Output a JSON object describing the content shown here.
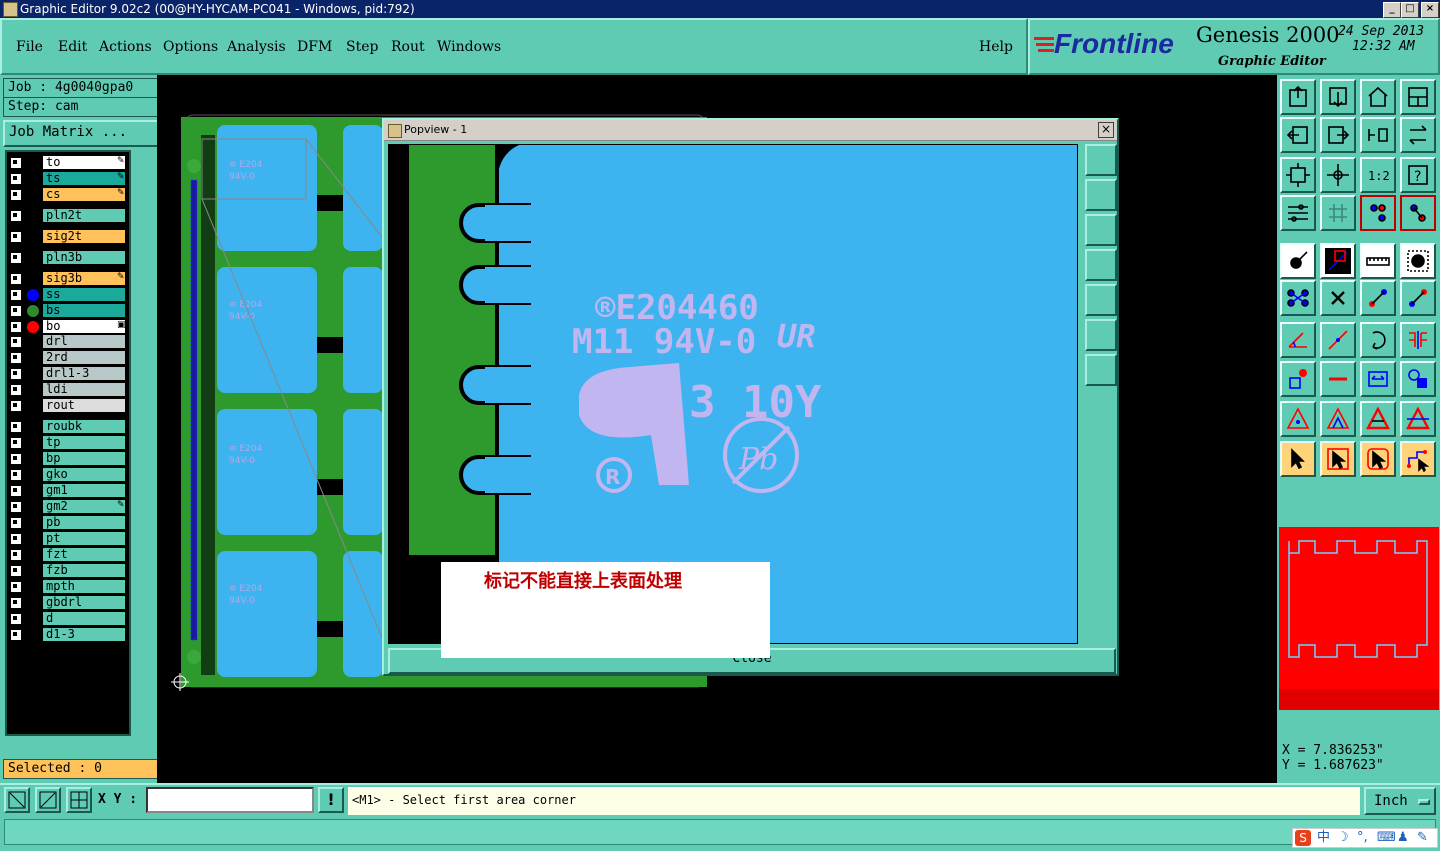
{
  "window": {
    "title": "Graphic Editor 9.02c2 (00@HY-HYCAM-PC041 - Windows, pid:792)"
  },
  "menu": [
    "File",
    "Edit",
    "Actions",
    "Options",
    "Analysis",
    "DFM",
    "Step",
    "Rout",
    "Windows"
  ],
  "help": "Help",
  "brand": {
    "logo": "Frontline",
    "product": "Genesis 2000",
    "subtitle": "Graphic Editor",
    "date": "24 Sep 2013",
    "time": "12:32 AM"
  },
  "job": {
    "job_label": "Job : 4g0040gpa0",
    "step_label": "Step: cam",
    "matrix_button": "Job Matrix ..."
  },
  "layers": [
    {
      "name": "to",
      "color": "#ffffff",
      "edit": true
    },
    {
      "name": "ts",
      "color": "#1aa99a",
      "edit": true
    },
    {
      "name": "cs",
      "color": "#ffc25a",
      "edit": true
    },
    {
      "name": "pln2t",
      "color": "#5fcbb3"
    },
    {
      "name": "sig2t",
      "color": "#ffc25a"
    },
    {
      "name": "pln3b",
      "color": "#5fcbb3"
    },
    {
      "name": "sig3b",
      "color": "#ffc25a",
      "edit": true
    },
    {
      "name": "ss",
      "color": "#1aa99a",
      "dot": "#0000ff"
    },
    {
      "name": "bs",
      "color": "#1aa99a",
      "dot": "#2e8b2e"
    },
    {
      "name": "bo",
      "color": "#ffffff",
      "dot": "#ff0000",
      "active": true
    },
    {
      "name": "drl",
      "color": "#b8c8c8"
    },
    {
      "name": "2rd",
      "color": "#b8c8c8"
    },
    {
      "name": "drl1-3",
      "color": "#b8c8c8"
    },
    {
      "name": "ldi",
      "color": "#b8c8c8"
    },
    {
      "name": "rout",
      "color": "#dcdcdc"
    },
    {
      "name": "roubk",
      "color": "#5fcbb3"
    },
    {
      "name": "tp",
      "color": "#5fcbb3"
    },
    {
      "name": "bp",
      "color": "#5fcbb3"
    },
    {
      "name": "gko",
      "color": "#5fcbb3"
    },
    {
      "name": "gm1",
      "color": "#5fcbb3"
    },
    {
      "name": "gm2",
      "color": "#5fcbb3",
      "edit": true
    },
    {
      "name": "pb",
      "color": "#5fcbb3"
    },
    {
      "name": "pt",
      "color": "#5fcbb3"
    },
    {
      "name": "fzt",
      "color": "#5fcbb3"
    },
    {
      "name": "fzb",
      "color": "#5fcbb3"
    },
    {
      "name": "mpth",
      "color": "#5fcbb3"
    },
    {
      "name": "gbdrl",
      "color": "#5fcbb3"
    },
    {
      "name": "d",
      "color": "#5fcbb3"
    },
    {
      "name": "d1-3",
      "color": "#5fcbb3"
    }
  ],
  "selected": "Selected : 0",
  "popview": {
    "title": "Popview - 1",
    "close_label": "Close",
    "marking": {
      "line1": "®E204460",
      "line2": "M11 94V-0",
      "ur": "UR",
      "date_code": "3 10Y",
      "pb": "Pb"
    }
  },
  "annotation": "标记不能直接上表面处理",
  "cursor_coords": {
    "x": "X = 7.836253\"",
    "y": "Y = 1.687623\""
  },
  "bottom": {
    "xy_label": "X Y :",
    "xy_value": "",
    "prompt": "<M1> - Select first area corner",
    "units": "Inch"
  },
  "colors": {
    "menu_bg": "#5fcbb3",
    "board_green": "#2e9a2e",
    "board_blue": "#3db4f0",
    "minimap_red": "#ff0000"
  },
  "icons": [
    "import-icon",
    "export-icon",
    "home-icon",
    "panel-icon",
    "prev-icon",
    "next-icon",
    "undo-zoom-icon",
    "redraw-icon",
    "fit-icon",
    "zoom-home-icon",
    "scale-icon",
    "help-icon",
    "settings-icon",
    "grid-icon",
    "snap-on-icon",
    "snap-off-icon",
    "pad-add-icon",
    "line-add-icon",
    "ruler-icon",
    "circle-icon",
    "connect-icon",
    "cross-icon",
    "move-icon",
    "copy-icon",
    "angle-icon",
    "line-draw-icon",
    "arc-icon",
    "step-icon",
    "pad-icon",
    "minus-icon",
    "measure-icon",
    "group-icon",
    "triangle-icon",
    "triangle-edit-icon",
    "triangle-move-icon",
    "triangle-rotate-icon",
    "pointer-icon",
    "pointer-select-icon",
    "pointer-alt-icon",
    "route-icon"
  ]
}
